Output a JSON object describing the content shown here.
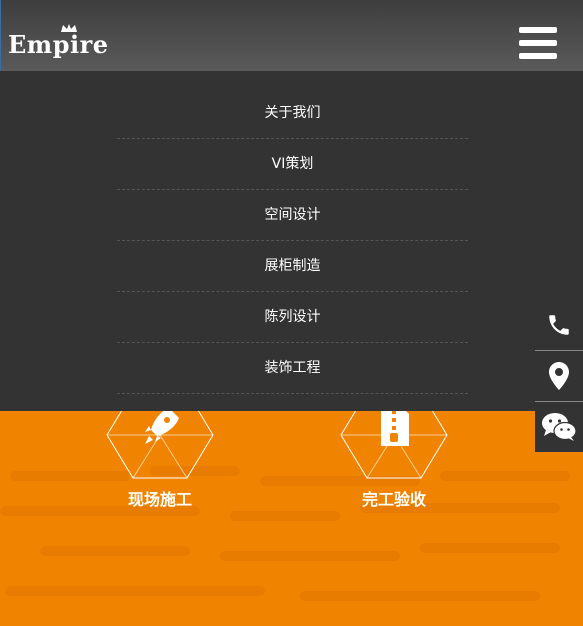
{
  "header": {
    "logo_text": "Empire",
    "menu_icon": "hamburger-menu-icon"
  },
  "menu": {
    "items": [
      {
        "label": "关于我们"
      },
      {
        "label": "VI策划"
      },
      {
        "label": "空间设计"
      },
      {
        "label": "展柜制造"
      },
      {
        "label": "陈列设计"
      },
      {
        "label": "装饰工程"
      }
    ]
  },
  "features": [
    {
      "label": "现场施工",
      "icon": "rocket-icon"
    },
    {
      "label": "完工验收",
      "icon": "zip-document-icon"
    }
  ],
  "sidebar": {
    "buttons": [
      {
        "icon": "phone-icon"
      },
      {
        "icon": "location-pin-icon"
      },
      {
        "icon": "wechat-icon"
      }
    ]
  },
  "colors": {
    "accent_orange": "#f08300",
    "menu_bg": "#333333",
    "header_bg": "#505050"
  }
}
